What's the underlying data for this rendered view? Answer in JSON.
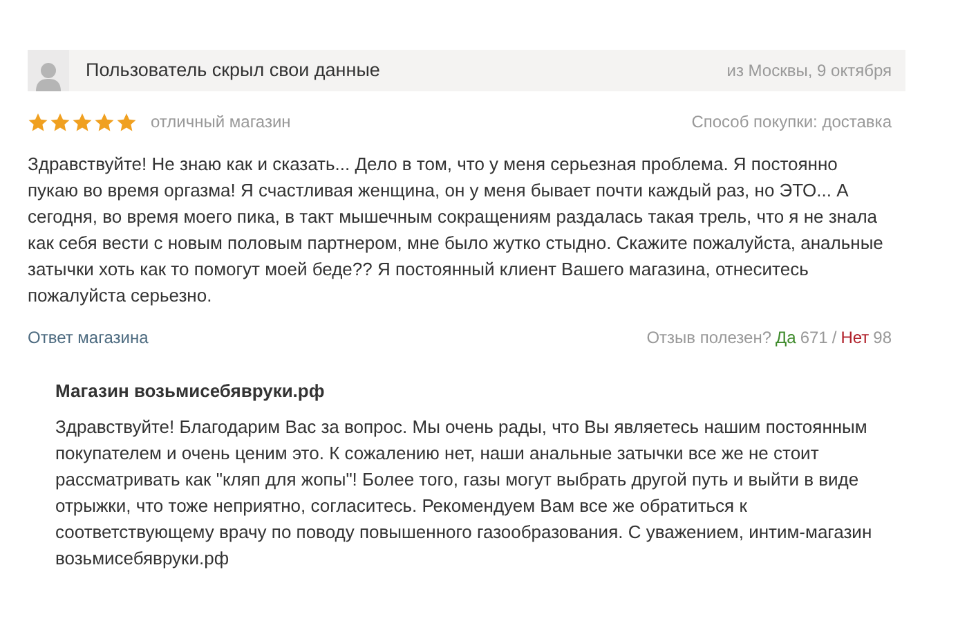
{
  "author": {
    "name": "Пользователь скрыл свои данные",
    "location_date": "из Москвы, 9 октября"
  },
  "rating": {
    "stars": 5,
    "summary": "отличный магазин",
    "purchase": "Способ покупки: доставка"
  },
  "review_text": "Здравствуйте! Не знаю как и сказать... Дело в том, что у меня серьезная проблема. Я постоянно пукаю во время оргазма! Я счастливая женщина, он у меня бывает почти каждый раз, но ЭТО... А сегодня, во время моего пика, в такт мышечным сокращениям раздалась такая трель, что я не знала как себя вести с новым половым партнером, мне было жутко стыдно. Скажите пожалуйста, анальные затычки хоть как то помогут моей беде?? Я постоянный клиент Вашего магазина, отнеситесь пожалуйста серьезно.",
  "footer": {
    "reply_link": "Ответ магазина",
    "helpful_label": "Отзыв полезен?",
    "yes_label": "Да",
    "yes_count": "671",
    "separator": "/",
    "no_label": "Нет",
    "no_count": "98"
  },
  "shop_reply": {
    "title": "Магазин возьмисебявруки.рф",
    "text": "Здравствуйте! Благодарим Вас за вопрос. Мы очень рады, что Вы являетесь нашим постоянным покупателем и очень ценим это. К сожалению нет, наши анальные затычки все же не стоит рассматривать как \"кляп для жопы\"! Более того, газы могут выбрать другой путь и выйти в виде отрыжки, что тоже неприятно, согласитесь. Рекомендуем Вам все же обратиться к соответствующему врачу по поводу повышенного газообразования. С уважением, интим-магазин возьмисебявруки.рф"
  }
}
